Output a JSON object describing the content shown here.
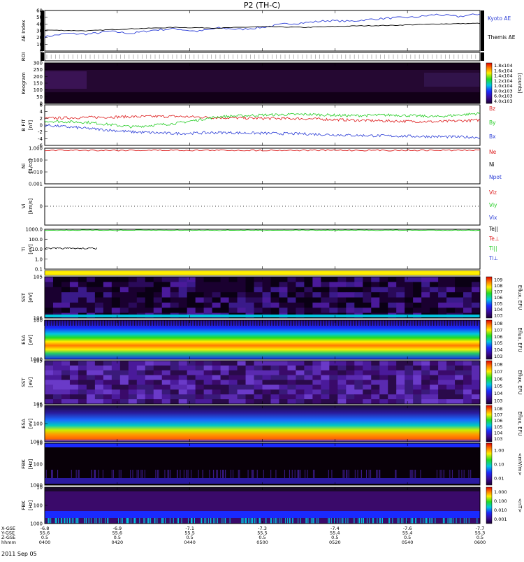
{
  "title": "P2 (TH-C)",
  "date": "2011 Sep 05",
  "colors": {
    "blue": "#2a3cd6",
    "red": "#dd1a1a",
    "green": "#22cc22",
    "black": "#000000",
    "yellow": "#ffee00"
  },
  "ephemeris": {
    "row_labels": [
      "X-GSE",
      "Y-GSE",
      "Z-GSE",
      "hhmm"
    ],
    "columns": [
      {
        "x": "-6.8",
        "y": "55.6",
        "z": "0.5",
        "t": "0400"
      },
      {
        "x": "-6.9",
        "y": "55.6",
        "z": "0.5",
        "t": "0420"
      },
      {
        "x": "-7.1",
        "y": "55.5",
        "z": "0.5",
        "t": "0440"
      },
      {
        "x": "-7.3",
        "y": "55.5",
        "z": "0.5",
        "t": "0500"
      },
      {
        "x": "-7.4",
        "y": "55.4",
        "z": "0.5",
        "t": "0520"
      },
      {
        "x": "-7.6",
        "y": "55.4",
        "z": "0.5",
        "t": "0540"
      },
      {
        "x": "-7.7",
        "y": "55.3",
        "z": "0.5",
        "t": "0600"
      }
    ]
  },
  "chart_data": [
    {
      "type": "line",
      "panel": "ae",
      "ylabel": "AE Index",
      "ylim": [
        0,
        60
      ],
      "yticks": [
        "0",
        "10",
        "20",
        "30",
        "40",
        "50",
        "60"
      ],
      "series": [
        {
          "name": "Kyoto AE",
          "color": "blue",
          "x": [
            0,
            0.05,
            0.1,
            0.15,
            0.2,
            0.25,
            0.3,
            0.35,
            0.4,
            0.45,
            0.5,
            0.55,
            0.6,
            0.65,
            0.7,
            0.75,
            0.8,
            0.85,
            0.9,
            0.95,
            1
          ],
          "values": [
            21,
            26,
            25,
            29,
            26,
            31,
            33,
            29,
            34,
            32,
            35,
            40,
            42,
            45,
            44,
            47,
            49,
            50,
            54,
            51,
            55
          ]
        },
        {
          "name": "Themis AE",
          "color": "black",
          "x": [
            0,
            0.1,
            0.2,
            0.3,
            0.4,
            0.5,
            0.6,
            0.7,
            0.8,
            0.9,
            1
          ],
          "values": [
            31,
            30,
            33,
            35,
            34,
            36,
            35,
            37,
            38,
            40,
            41
          ]
        }
      ]
    },
    {
      "type": "strip",
      "panel": "roi",
      "ylabel": "ROI"
    },
    {
      "type": "heatmap",
      "panel": "keogram",
      "ylabel": "Keogram",
      "ylim": [
        0,
        300
      ],
      "yticks": [
        "0",
        "50",
        "100",
        "150",
        "200",
        "250",
        "300"
      ],
      "colorbar": {
        "label": "[counts]",
        "ticks": [
          "1.8x10^4",
          "1.6x10^4",
          "1.4x10^4",
          "1.2x10^4",
          "1.0x10^4",
          "8.0x10^3",
          "6.0x10^3",
          "4.0x10^3"
        ]
      }
    },
    {
      "type": "line",
      "panel": "bfield",
      "ylabel": "B FIT",
      "unit": "[nT]",
      "ylim": [
        -6,
        6
      ],
      "yticks": [
        "-6",
        "-4",
        "-2",
        "0",
        "2",
        "4",
        "6"
      ],
      "series": [
        {
          "name": "Bz",
          "color": "red",
          "x": [
            0,
            0.1,
            0.2,
            0.3,
            0.4,
            0.5,
            0.6,
            0.7,
            0.8,
            0.9,
            1
          ],
          "values": [
            2,
            2.3,
            2.5,
            2.6,
            2.2,
            2.0,
            1.9,
            1.5,
            1.2,
            1.0,
            1.5
          ]
        },
        {
          "name": "By",
          "color": "green",
          "x": [
            0,
            0.1,
            0.2,
            0.3,
            0.4,
            0.5,
            0.6,
            0.7,
            0.8,
            0.9,
            1
          ],
          "values": [
            1.2,
            0.8,
            -0.5,
            0.5,
            2.5,
            3.0,
            3.2,
            2.8,
            3.0,
            2.5,
            3.5
          ]
        },
        {
          "name": "Bx",
          "color": "blue",
          "x": [
            0,
            0.1,
            0.2,
            0.3,
            0.4,
            0.5,
            0.6,
            0.7,
            0.8,
            0.9,
            1
          ],
          "values": [
            0,
            -1,
            -2,
            -2.5,
            -2.2,
            -2.4,
            -2.6,
            -3,
            -3.2,
            -3.4,
            -3.6
          ]
        }
      ]
    },
    {
      "type": "line",
      "panel": "density",
      "ylabel": "Ni",
      "unit": "[1/cc]",
      "log": true,
      "ylim": [
        0.001,
        1.0
      ],
      "yticks": [
        "0.001",
        "0.010",
        "0.100",
        "1.000"
      ],
      "legend": [
        "Ne",
        "Ni",
        "Npot"
      ]
    },
    {
      "type": "line",
      "panel": "velocity",
      "ylabel": "Vi",
      "unit": "[km/s]",
      "yticks": [
        "0"
      ],
      "legend": [
        "Viz",
        "Viy",
        "Vix"
      ]
    },
    {
      "type": "line",
      "panel": "temp",
      "ylabel": "Ti",
      "unit": "[eV]",
      "log": true,
      "ylim": [
        0.1,
        1000.0
      ],
      "yticks": [
        "0.1",
        "1.0",
        "10.0",
        "100.0",
        "1000.0"
      ],
      "legend": [
        "Te||",
        "Te⊥",
        "Ti||",
        "Ti⊥"
      ]
    },
    {
      "type": "strip",
      "panel": "mode",
      "ylabel": ""
    },
    {
      "type": "heatmap",
      "panel": "sst_e",
      "ylabel": "SST",
      "unit": "[eV]",
      "yticks": [
        "10^6",
        "10^5"
      ],
      "colorbar": {
        "label": "Eflux, EFU",
        "ticks": [
          "10^9",
          "10^8",
          "10^7",
          "10^6",
          "10^5",
          "10^4",
          "10^3"
        ]
      }
    },
    {
      "type": "heatmap",
      "panel": "esa_e",
      "ylabel": "ESA",
      "unit": "[eV]",
      "yticks": [
        "1000",
        "100"
      ],
      "colorbar": {
        "label": "Eflux, EFU",
        "ticks": [
          "10^8",
          "10^7",
          "10^6",
          "10^5",
          "10^4",
          "10^3"
        ]
      }
    },
    {
      "type": "heatmap",
      "panel": "sst_i",
      "ylabel": "SST",
      "unit": "[eV]",
      "yticks": [
        "10^6",
        "10^5"
      ],
      "colorbar": {
        "label": "Eflux, EFU",
        "ticks": [
          "10^8",
          "10^7",
          "10^6",
          "10^5",
          "10^4",
          "10^3"
        ]
      }
    },
    {
      "type": "heatmap",
      "panel": "esa_i",
      "ylabel": "ESA",
      "unit": "[eV]",
      "yticks": [
        "1000",
        "100",
        "10"
      ],
      "colorbar": {
        "label": "Eflux, EFU",
        "ticks": [
          "10^8",
          "10^7",
          "10^6",
          "10^5",
          "10^4",
          "10^3"
        ]
      }
    },
    {
      "type": "heatmap",
      "panel": "fbk1",
      "ylabel": "FBK",
      "unit": "[Hz]",
      "yticks": [
        "1000",
        "100",
        "10"
      ],
      "colorbar": {
        "label": "<mV/m>",
        "ticks": [
          "1.00",
          "0.10",
          "0.01"
        ]
      }
    },
    {
      "type": "heatmap",
      "panel": "fbk2",
      "ylabel": "FBK",
      "unit": "[Hz]",
      "yticks": [
        "1000",
        "100",
        "10"
      ],
      "colorbar": {
        "label": "<nT>",
        "ticks": [
          "1.000",
          "0.100",
          "0.010",
          "0.001"
        ]
      }
    }
  ]
}
